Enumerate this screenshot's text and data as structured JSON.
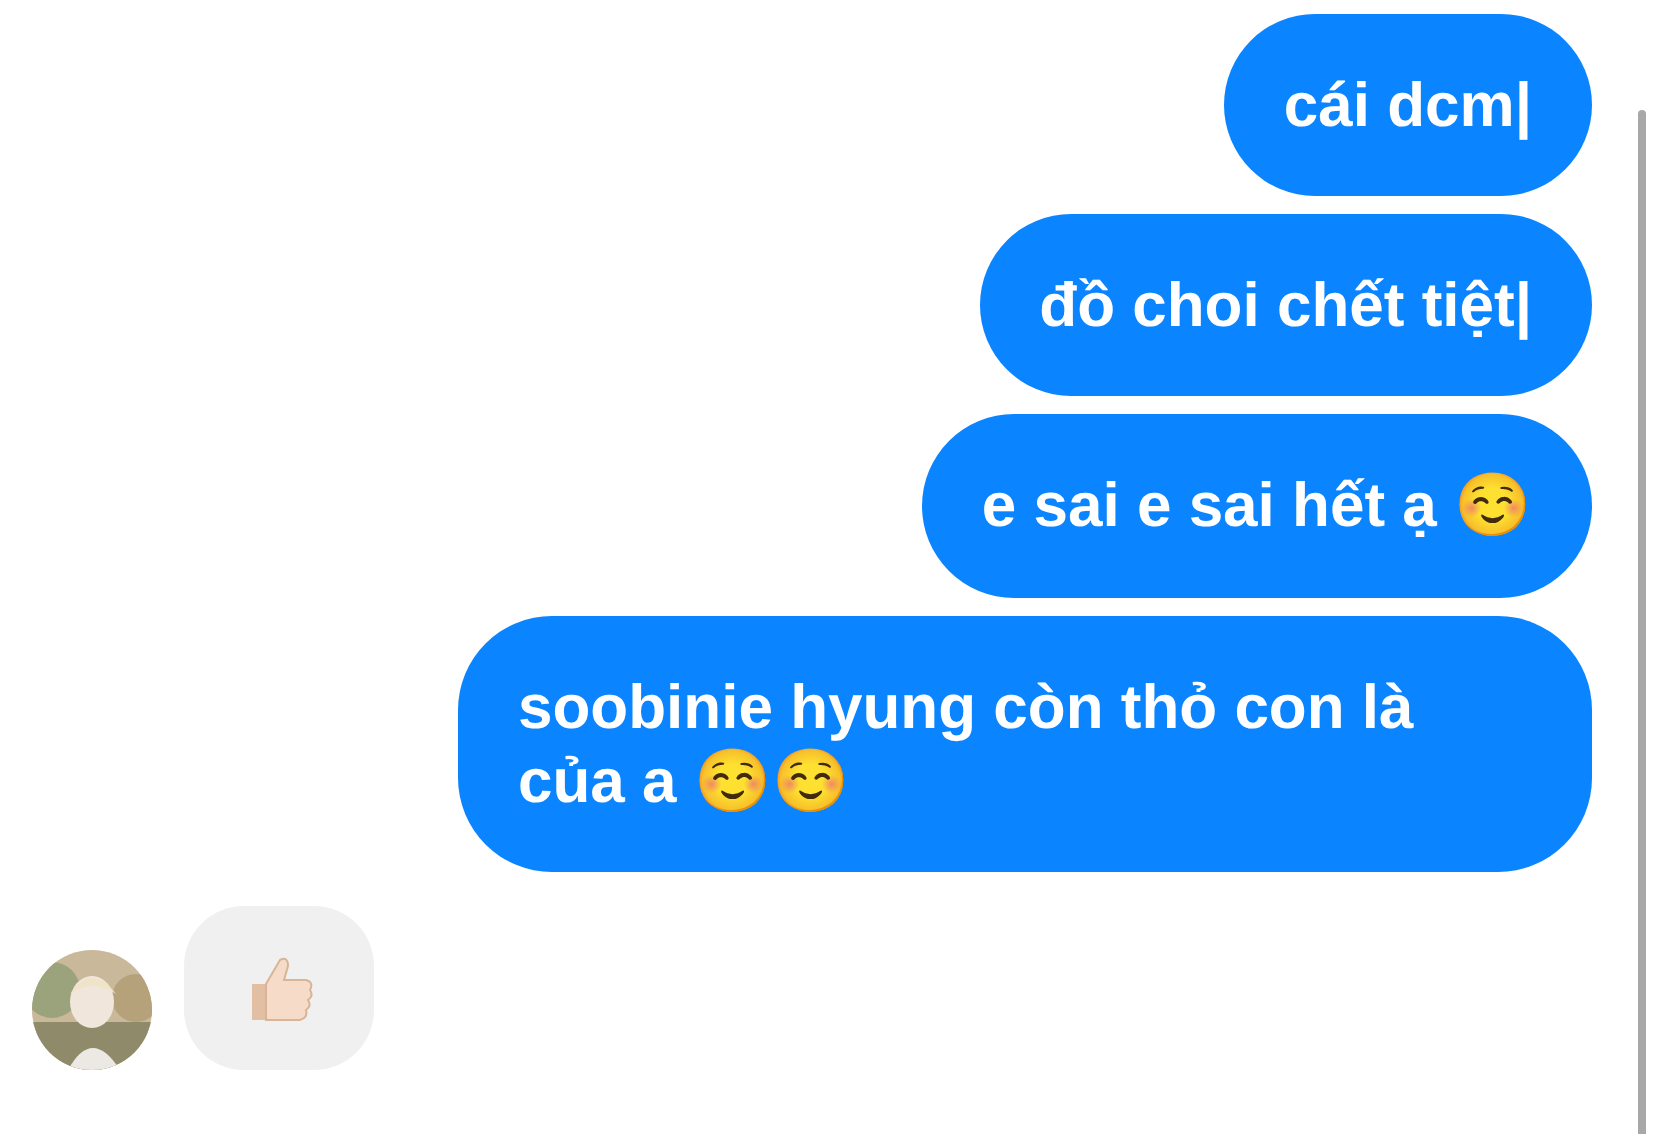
{
  "messages": [
    {
      "kind": "text",
      "outgoing": true,
      "text": "cái dcm|"
    },
    {
      "kind": "text",
      "outgoing": true,
      "text": "đồ choi chết tiệt|"
    },
    {
      "kind": "text",
      "outgoing": true,
      "text": "e sai e sai hết ạ ☺️"
    },
    {
      "kind": "text",
      "outgoing": true,
      "text": "soobinie hyung còn thỏ con là của a ☺️☺️"
    },
    {
      "kind": "like",
      "outgoing": false
    }
  ]
}
